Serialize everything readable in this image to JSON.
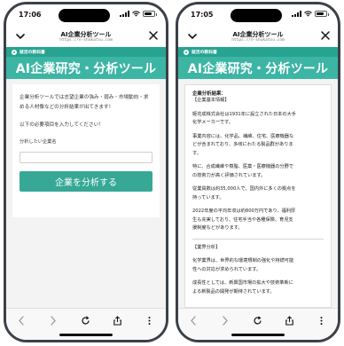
{
  "left_phone": {
    "status": {
      "time": "17:06"
    },
    "header": {
      "title": "AI企業分析ツール",
      "url": "https://n-shukatsu.com"
    },
    "brand": "就活の教科書",
    "heading": "AI企業研究・分析ツール",
    "form": {
      "intro": "企業分析ツールでは志望企業の強み・弱み・市場動向・求める人材像などの分析結果が出てきます！",
      "prompt": "以下の必要項目を入力してください！",
      "field_label": "分析したい企業名",
      "field_value": "",
      "submit_label": "企業を分析する"
    }
  },
  "right_phone": {
    "status": {
      "time": "17:05"
    },
    "header": {
      "title": "AI企業分析ツール",
      "url": "https://n-shukatsu.com"
    },
    "brand": "就活の教科書",
    "heading": "AI企業研究・分析ツール",
    "result": {
      "title": "企業分析結果：",
      "section1": "【企業基本情報】",
      "p1": [
        "姫花成株式会社は1931年に設立された日本の大手",
        "化学メーカーです。"
      ],
      "p2": [
        "事業内容には、化学品、繊維、住宅、医療機器な",
        "どが含まれており、多岐にわたる製品群がありま",
        "す。"
      ],
      "p3": [
        "特に、合成繊維や樹脂、医薬・医療機器の分野で",
        "の技術力が高く評価されています。"
      ],
      "p4": [
        "従業員数は約35,000人で、国内外に多くの拠点を",
        "持っています。"
      ],
      "p5": [
        "2022年度の平均年収は約800万円であり、福利厚",
        "生も充実しており、住宅手当や各種保険、育児支",
        "援制度などがあります。"
      ],
      "section2": "【業界分析】",
      "p6": [
        "化学業界は、世界的な環境規制の強化や持続可能",
        "性への対応が求められています。"
      ],
      "p7": [
        "成長性としては、新興国市場の拡大や技術革新に",
        "よる新製品の開発が期待されています。"
      ]
    }
  },
  "colors": {
    "brand_dark": "#27a391",
    "brand": "#3cb5a4",
    "button": "#36a895"
  },
  "icons": [
    "chevron-down-icon",
    "close-icon",
    "back-icon",
    "forward-icon",
    "reload-icon",
    "share-icon",
    "more-icon"
  ]
}
